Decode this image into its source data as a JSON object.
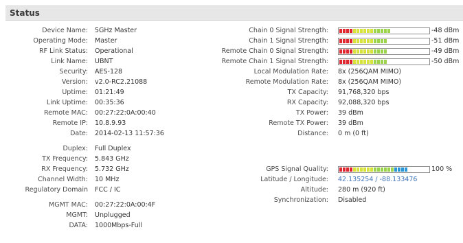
{
  "header": {
    "title": "Status"
  },
  "left": [
    {
      "label": "Device Name:",
      "value": "5GHz Master"
    },
    {
      "label": "Operating Mode:",
      "value": "Master"
    },
    {
      "label": "RF Link Status:",
      "value": "Operational"
    },
    {
      "label": "Link Name:",
      "value": "UBNT"
    },
    {
      "label": "Security:",
      "value": "AES-128"
    },
    {
      "label": "Version:",
      "value": "v2.0-RC2.21088"
    },
    {
      "label": "Uptime:",
      "value": "01:21:49"
    },
    {
      "label": "Link Uptime:",
      "value": "00:35:36"
    },
    {
      "label": "Remote MAC:",
      "value": "00:27:22:0A:00:40"
    },
    {
      "label": "Remote IP:",
      "value": "10.8.9.93"
    },
    {
      "label": "Date:",
      "value": "2014-02-13 11:57:36"
    },
    {
      "label": "Duplex:",
      "value": "Full Duplex"
    },
    {
      "label": "TX Frequency:",
      "value": "5.843 GHz"
    },
    {
      "label": "RX Frequency:",
      "value": "5.732 GHz"
    },
    {
      "label": "Channel Width:",
      "value": "10 MHz"
    },
    {
      "label": "Regulatory Domain",
      "value": "FCC / IC"
    },
    {
      "label": "MGMT MAC:",
      "value": "00:27:22:0A:00:4F"
    },
    {
      "label": "MGMT:",
      "value": "Unplugged"
    },
    {
      "label": "DATA:",
      "value": "1000Mbps-Full"
    }
  ],
  "right_meters": [
    {
      "label": "Chain 0 Signal Strength:",
      "readout": "-48 dBm",
      "level": 0.73
    },
    {
      "label": "Chain 1 Signal Strength:",
      "readout": "-51 dBm",
      "level": 0.68
    },
    {
      "label": "Remote Chain 0 Signal Strength:",
      "readout": "-49 dBm",
      "level": 0.71
    },
    {
      "label": "Remote Chain 1 Signal Strength:",
      "readout": "-50 dBm",
      "level": 0.69
    }
  ],
  "right": [
    {
      "label": "Local Modulation Rate:",
      "value": "8x (256QAM MIMO)"
    },
    {
      "label": "Remote Modulation Rate:",
      "value": "8x (256QAM MIMO)"
    },
    {
      "label": "TX Capacity:",
      "value": "91,768,320 bps"
    },
    {
      "label": "RX Capacity:",
      "value": "92,088,320 bps"
    },
    {
      "label": "TX Power:",
      "value": "39 dBm"
    },
    {
      "label": "Remote TX Power:",
      "value": "39 dBm"
    },
    {
      "label": "Distance:",
      "value": "0 m (0 ft)"
    }
  ],
  "gps": {
    "label": "GPS Signal Quality:",
    "readout": "100 %",
    "level": 1.0,
    "latlon_label": "Latitude / Longitude:",
    "latlon_value": "42.135254 / -88.133476",
    "altitude_label": "Altitude:",
    "altitude_value": "280 m (920 ft)",
    "sync_label": "Synchronization:",
    "sync_value": "Disabled"
  },
  "colors": {
    "meter_red": "#e0262e",
    "meter_yellow": "#d7e33a",
    "meter_green": "#9bd34a",
    "meter_blue": "#2b97d7",
    "link": "#3f74b8"
  }
}
